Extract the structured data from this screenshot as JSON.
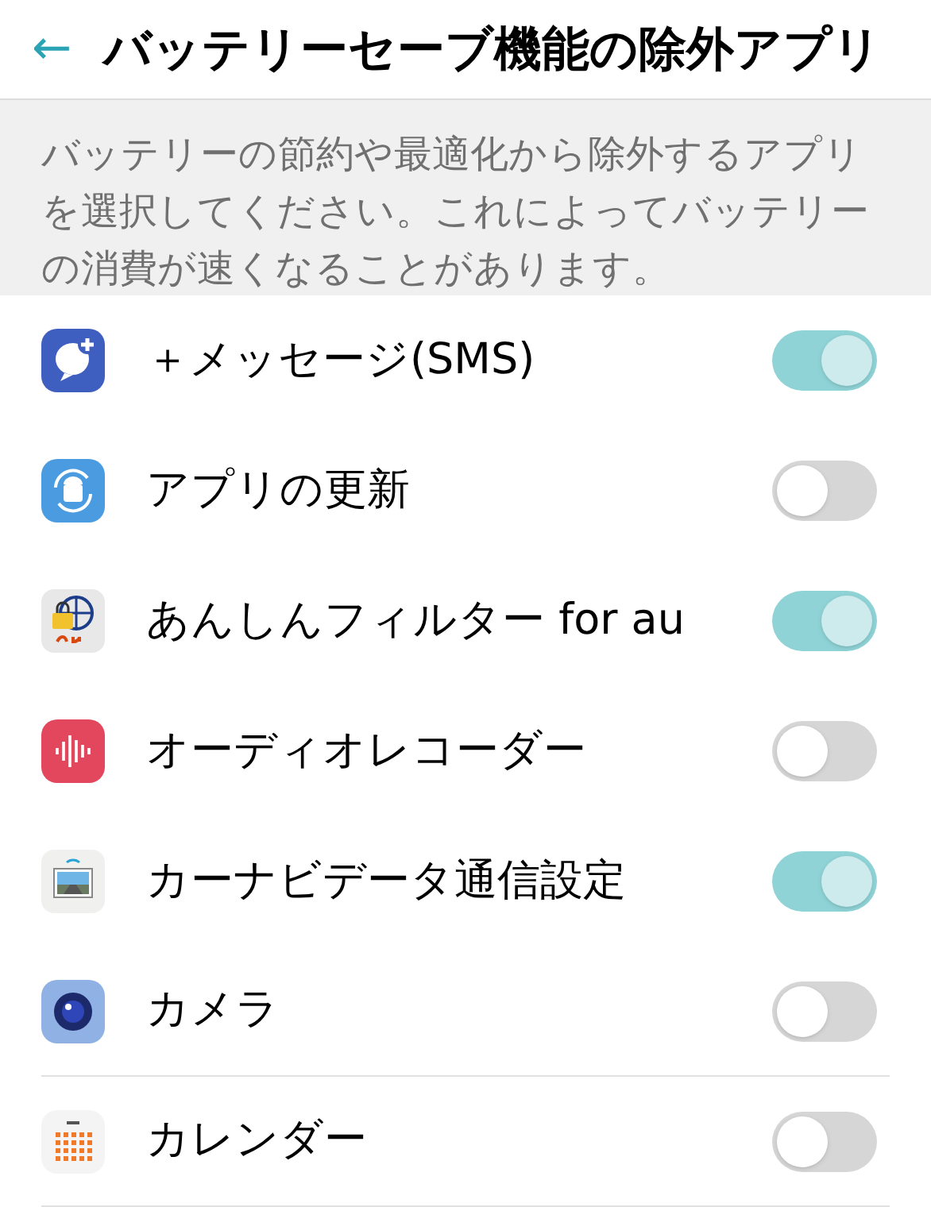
{
  "header": {
    "back": "←",
    "title": "バッテリーセーブ機能の除外アプリ"
  },
  "description": "バッテリーの節約や最適化から除外するアプリを選択してください。これによってバッテリーの消費が速くなることがあります。",
  "apps": [
    {
      "name": "＋メッセージ(SMS)",
      "kind": "message",
      "on": true
    },
    {
      "name": "アプリの更新",
      "kind": "update",
      "on": false
    },
    {
      "name": "あんしんフィルター for au",
      "kind": "filter",
      "on": true
    },
    {
      "name": "オーディオレコーダー",
      "kind": "recorder",
      "on": false
    },
    {
      "name": "カーナビデータ通信設定",
      "kind": "navi",
      "on": true
    },
    {
      "name": "カメラ",
      "kind": "camera",
      "on": false
    },
    {
      "name": "カレンダー",
      "kind": "calendar",
      "on": false
    }
  ]
}
